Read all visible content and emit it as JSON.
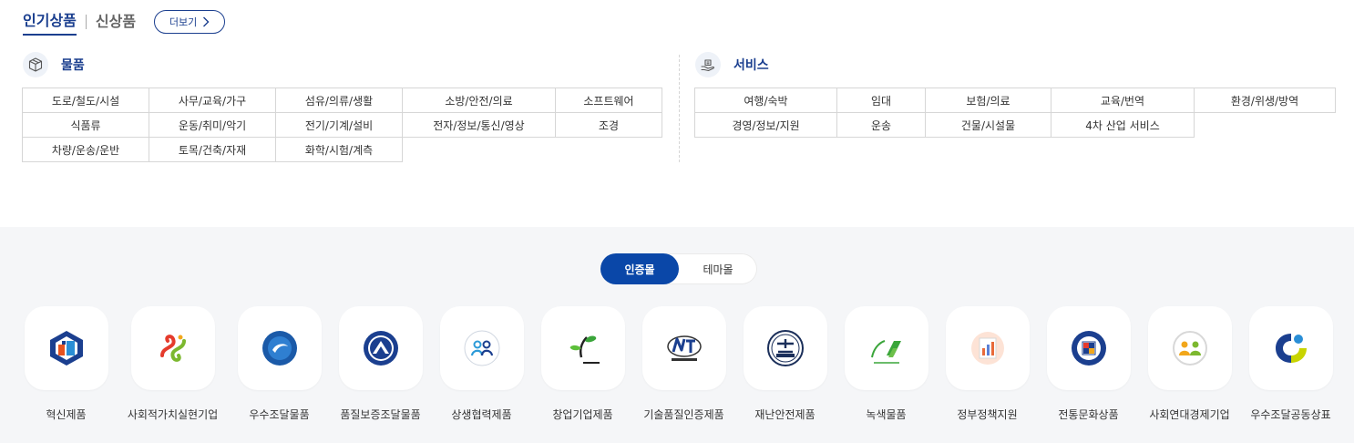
{
  "tabs": {
    "popular": "인기상품",
    "new": "신상품",
    "more": "더보기"
  },
  "goods": {
    "title": "물품",
    "items": [
      "도로/철도/시설",
      "사무/교육/가구",
      "섬유/의류/생활",
      "소방/안전/의료",
      "소프트웨어",
      "식품류",
      "운동/취미/악기",
      "전기/기계/설비",
      "전자/정보/통신/영상",
      "조경",
      "차량/운송/운반",
      "토목/건축/자재",
      "화학/시험/계측"
    ]
  },
  "services": {
    "title": "서비스",
    "items": [
      "여행/숙박",
      "임대",
      "보험/의료",
      "교육/번역",
      "환경/위생/방역",
      "경영/정보/지원",
      "운송",
      "건물/시설물",
      "4차 산업 서비스"
    ]
  },
  "toggle": {
    "cert": "인증몰",
    "theme": "테마몰"
  },
  "certs": [
    {
      "label": "혁신제품",
      "icon": "innovation-product-icon"
    },
    {
      "label": "사회적가치실현기업",
      "icon": "social-value-icon"
    },
    {
      "label": "우수조달물품",
      "icon": "excellent-procurement-icon"
    },
    {
      "label": "품질보증조달물품",
      "icon": "quality-assurance-icon"
    },
    {
      "label": "상생협력제품",
      "icon": "win-win-cooperation-icon"
    },
    {
      "label": "창업기업제품",
      "icon": "startup-icon"
    },
    {
      "label": "기술품질인증제품",
      "icon": "tech-quality-icon"
    },
    {
      "label": "재난안전제품",
      "icon": "disaster-safety-icon"
    },
    {
      "label": "녹색물품",
      "icon": "green-certification-icon"
    },
    {
      "label": "정부정책지원",
      "icon": "policy-support-icon"
    },
    {
      "label": "전통문화상품",
      "icon": "traditional-culture-icon"
    },
    {
      "label": "사회연대경제기업",
      "icon": "social-solidarity-icon"
    },
    {
      "label": "우수조달공동상표",
      "icon": "joint-brand-icon"
    }
  ],
  "colors": {
    "brand": "#1b3f8f",
    "toggle_active": "#0a47a8"
  }
}
